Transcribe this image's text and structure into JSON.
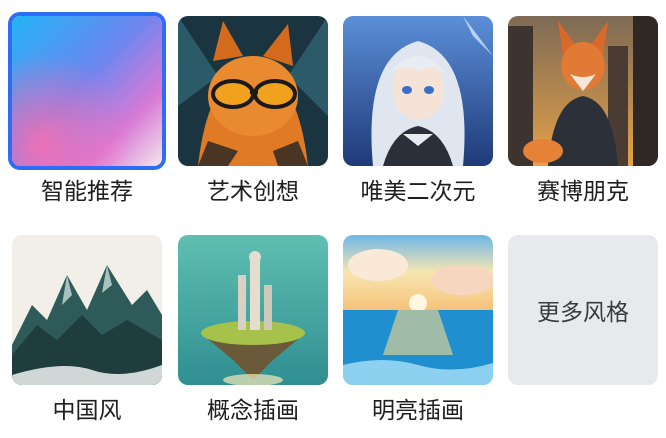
{
  "styles": [
    {
      "label": "智能推荐",
      "selected": true
    },
    {
      "label": "艺术创想",
      "selected": false
    },
    {
      "label": "唯美二次元",
      "selected": false
    },
    {
      "label": "赛博朋克",
      "selected": false
    },
    {
      "label": "中国风",
      "selected": false
    },
    {
      "label": "概念插画",
      "selected": false
    },
    {
      "label": "明亮插画",
      "selected": false
    }
  ],
  "more_label": "更多风格",
  "colors": {
    "selected_border": "#2f6cf5",
    "more_bg": "#e8e9ec"
  }
}
